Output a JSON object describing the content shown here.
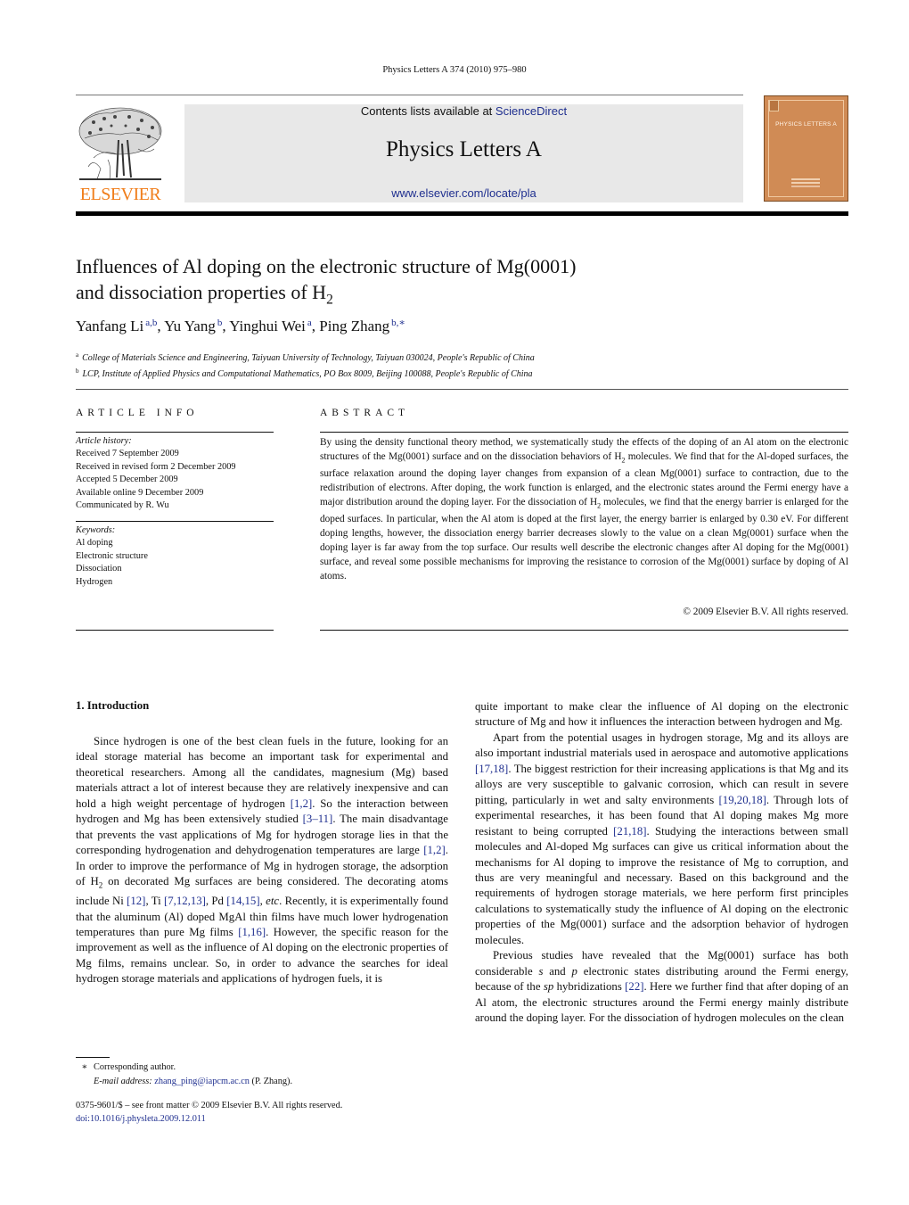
{
  "running_head": "Physics Letters A 374 (2010) 975–980",
  "masthead": {
    "contents_prefix": "Contents lists available at ",
    "contents_link": "ScienceDirect",
    "journal_title": "Physics Letters A",
    "journal_url": "www.elsevier.com/locate/pla",
    "publisher_logo_text": "ELSEVIER",
    "cover_title": "PHYSICS LETTERS A",
    "colors": {
      "publisher_orange": "#f07d1a",
      "masthead_bg": "#e8e8e8",
      "cover": "#d08b55",
      "link": "#1f2f8f"
    }
  },
  "article": {
    "title_line1": "Influences of Al doping on the electronic structure of Mg(0001)",
    "title_line2_prefix": "and dissociation properties of H",
    "title_line2_sub": "2",
    "authors": [
      {
        "name": "Yanfang Li",
        "aff": "a,b",
        "sep": ", "
      },
      {
        "name": "Yu Yang",
        "aff": "b",
        "sep": ", "
      },
      {
        "name": "Yinghui Wei",
        "aff": "a",
        "sep": ", "
      },
      {
        "name": "Ping Zhang",
        "aff": "b,∗",
        "sep": ""
      }
    ],
    "affiliations": [
      {
        "mark": "a",
        "text": "College of Materials Science and Engineering, Taiyuan University of Technology, Taiyuan 030024, People's Republic of China"
      },
      {
        "mark": "b",
        "text": "LCP, Institute of Applied Physics and Computational Mathematics, PO Box 8009, Beijing 100088, People's Republic of China"
      }
    ]
  },
  "article_info": {
    "heading": "ARTICLE INFO",
    "history_label": "Article history:",
    "history": [
      "Received 7 September 2009",
      "Received in revised form 2 December 2009",
      "Accepted 5 December 2009",
      "Available online 9 December 2009",
      "Communicated by R. Wu"
    ],
    "keywords_label": "Keywords:",
    "keywords": [
      "Al doping",
      "Electronic structure",
      "Dissociation",
      "Hydrogen"
    ]
  },
  "abstract": {
    "heading": "ABSTRACT",
    "part1": "By using the density functional theory method, we systematically study the effects of the doping of an Al atom on the electronic structures of the Mg(0001) surface and on the dissociation behaviors of H",
    "part2": " molecules. We find that for the Al-doped surfaces, the surface relaxation around the doping layer changes from expansion of a clean Mg(0001) surface to contraction, due to the redistribution of electrons. After doping, the work function is enlarged, and the electronic states around the Fermi energy have a major distribution around the doping layer. For the dissociation of H",
    "part3": " molecules, we find that the energy barrier is enlarged for the doped surfaces. In particular, when the Al atom is doped at the first layer, the energy barrier is enlarged by 0.30 eV. For different doping lengths, however, the dissociation energy barrier decreases slowly to the value on a clean Mg(0001) surface when the doping layer is far away from the top surface. Our results well describe the electronic changes after Al doping for the Mg(0001) surface, and reveal some possible mechanisms for improving the resistance to corrosion of the Mg(0001) surface by doping of Al atoms.",
    "sub": "2",
    "copyright": "© 2009 Elsevier B.V. All rights reserved."
  },
  "intro": {
    "heading": "1. Introduction",
    "p1": [
      {
        "t": "Since hydrogen is one of the best clean fuels in the future, looking for an ideal storage material has become an important task for experimental and theoretical researchers. Among all the candidates, magnesium (Mg) based materials attract a lot of interest because they are relatively inexpensive and can hold a high weight percentage of hydrogen "
      },
      {
        "ref": "[1,2]"
      },
      {
        "t": ". So the interaction between hydrogen and Mg has been extensively studied "
      },
      {
        "ref": "[3–11]"
      },
      {
        "t": ". The main disadvantage that prevents the vast applications of Mg for hydrogen storage lies in that the corresponding hydrogenation and dehydrogenation temperatures are large "
      },
      {
        "ref": "[1,2]"
      },
      {
        "t": ". In order to improve the performance of Mg in hydrogen storage, the adsorption of H"
      },
      {
        "sub": "2"
      },
      {
        "t": " on decorated Mg surfaces are being considered. The decorating atoms include Ni "
      },
      {
        "ref": "[12]"
      },
      {
        "t": ", Ti "
      },
      {
        "ref": "[7,12,13]"
      },
      {
        "t": ", Pd "
      },
      {
        "ref": "[14,15]"
      },
      {
        "t": ", "
      },
      {
        "i": "etc"
      },
      {
        "t": ". Recently, it is experimentally found that the aluminum (Al) doped MgAl thin films have much lower hydrogenation temperatures than pure Mg films "
      },
      {
        "ref": "[1,16]"
      },
      {
        "t": ". However, the specific reason for the improvement as well as the influence of Al doping on the electronic properties of Mg films, remains unclear. So, in order to advance the searches for ideal hydrogen storage materials and applications of hydrogen fuels, it is quite important to make clear the influence of Al doping on the electronic structure of Mg and how it influences the interaction between hydrogen and Mg."
      }
    ],
    "p1_split_left": "Since hydrogen is one of the best clean fuels in the future, looking for an ideal storage material has become an important task for experimental and theoretical researchers. Among all the candidates, magnesium (Mg) based materials attract a lot of in­terest because they are relatively inexpensive and can hold a high weight percentage of hydrogen ",
    "right_p1": "quite important to make clear the influence of Al doping on the electronic structure of Mg and how it influences the interaction between hydrogen and Mg.",
    "p2": [
      {
        "t": "Apart from the potential usages in hydrogen storage, Mg and its alloys are also important industrial materials used in aerospace and automotive applications "
      },
      {
        "ref": "[17,18]"
      },
      {
        "t": ". The biggest restriction for their increasing applications is that Mg and its alloys are very susceptible to galvanic corrosion, which can result in severe pitting, particularly in wet and salty environments "
      },
      {
        "ref": "[19,20,18]"
      },
      {
        "t": ". Through lots of experimental researches, it has been found that Al doping makes Mg more resistant to being corrupted "
      },
      {
        "ref": "[21,18]"
      },
      {
        "t": ". Studying the interactions between small molecules and Al-doped Mg surfaces can give us critical information about the mechanisms for Al doping to improve the resistance of Mg to corruption, and thus are very meaningful and necessary. Based on this background and the requirements of hydrogen storage materials, we here perform first principles calculations to systematically study the influence of Al doping on the electronic properties of the Mg(0001) surface and the adsorption behavior of hydrogen molecules."
      }
    ],
    "p3": [
      {
        "t": "Previous studies have revealed that the Mg(0001) surface has both considerable "
      },
      {
        "i": "s"
      },
      {
        "t": " and "
      },
      {
        "i": "p"
      },
      {
        "t": " electronic states distributing around the Fermi energy, because of the "
      },
      {
        "i": "sp"
      },
      {
        "t": " hybridizations "
      },
      {
        "ref": "[22]"
      },
      {
        "t": ". Here we further find that after doping of an Al atom, the electronic structures around the Fermi energy mainly distribute around the doping layer. For the dissociation of hydrogen molecules on the clean"
      }
    ]
  },
  "footnotes": {
    "star": "∗",
    "corresponding": "Corresponding author.",
    "email_label": "E-mail address:",
    "email": "zhang_ping@iapcm.ac.cn",
    "email_suffix": " (P. Zhang).",
    "front_matter": "0375-9601/$ – see front matter  © 2009 Elsevier B.V. All rights reserved.",
    "doi": "doi:10.1016/j.physleta.2009.12.011"
  }
}
